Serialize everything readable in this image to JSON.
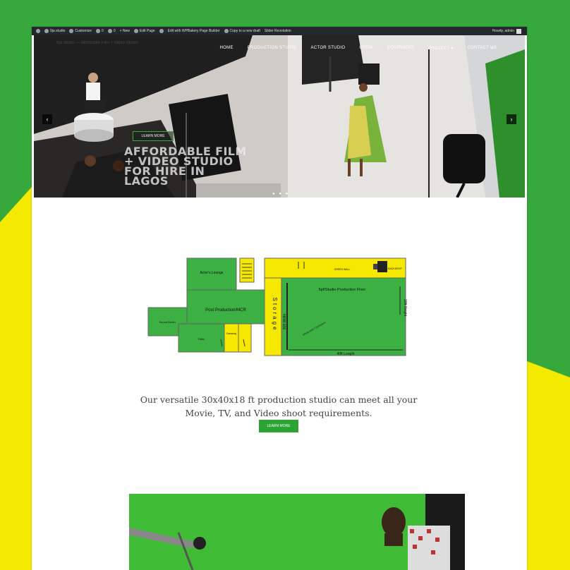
{
  "admin_bar": {
    "items": [
      "9ja studio",
      "Customize",
      "0",
      "0",
      "+ New",
      "Edit Page",
      "",
      "Edit with WPBakery Page Builder",
      "Copy to a new draft",
      "Slider Revolution"
    ],
    "greeting": "Howdy, admin"
  },
  "nav": {
    "logo_text": "9ja studio — Affordable Film + Video Studio",
    "menu": [
      "HOME",
      "PRODUCTION STUDIO",
      "ACTOR STUDIO",
      "CREW",
      "EQUIPMENT",
      "PROJECT ▾",
      "CONTACT US"
    ]
  },
  "hero": {
    "button_label": "LEARN MORE",
    "title_lines": [
      "AFFORDABLE FILM",
      "+ VIDEO STUDIO",
      "FOR HIRE IN",
      "LAGOS"
    ]
  },
  "floor_plan": {
    "labels": {
      "lounge": "Actor's Lounge",
      "post_production": "Post Production/MCR",
      "reception": "Sound Booth",
      "toilet": "Toilet",
      "dressing": "Dressing",
      "storage": "Storage",
      "studio": "5pf/Studio Production Floor",
      "height": "18ft Height",
      "width": "30ft Width",
      "length": "40ft Length",
      "infinity": "infinity wall / Cyclorama",
      "green_wall": "GREEN WALL",
      "backlot": "BACKDROP"
    }
  },
  "intro": {
    "line1": "Our versatile 30x40x18 ft production studio can meet all your",
    "line2": "Movie, TV, and Video shoot requirements.",
    "button_label": "LEARN MORE"
  },
  "colors": {
    "brand_green": "#36a83c",
    "brand_yellow": "#ffee00",
    "plan_green": "#3cb043",
    "plan_yellow": "#f6e800"
  }
}
